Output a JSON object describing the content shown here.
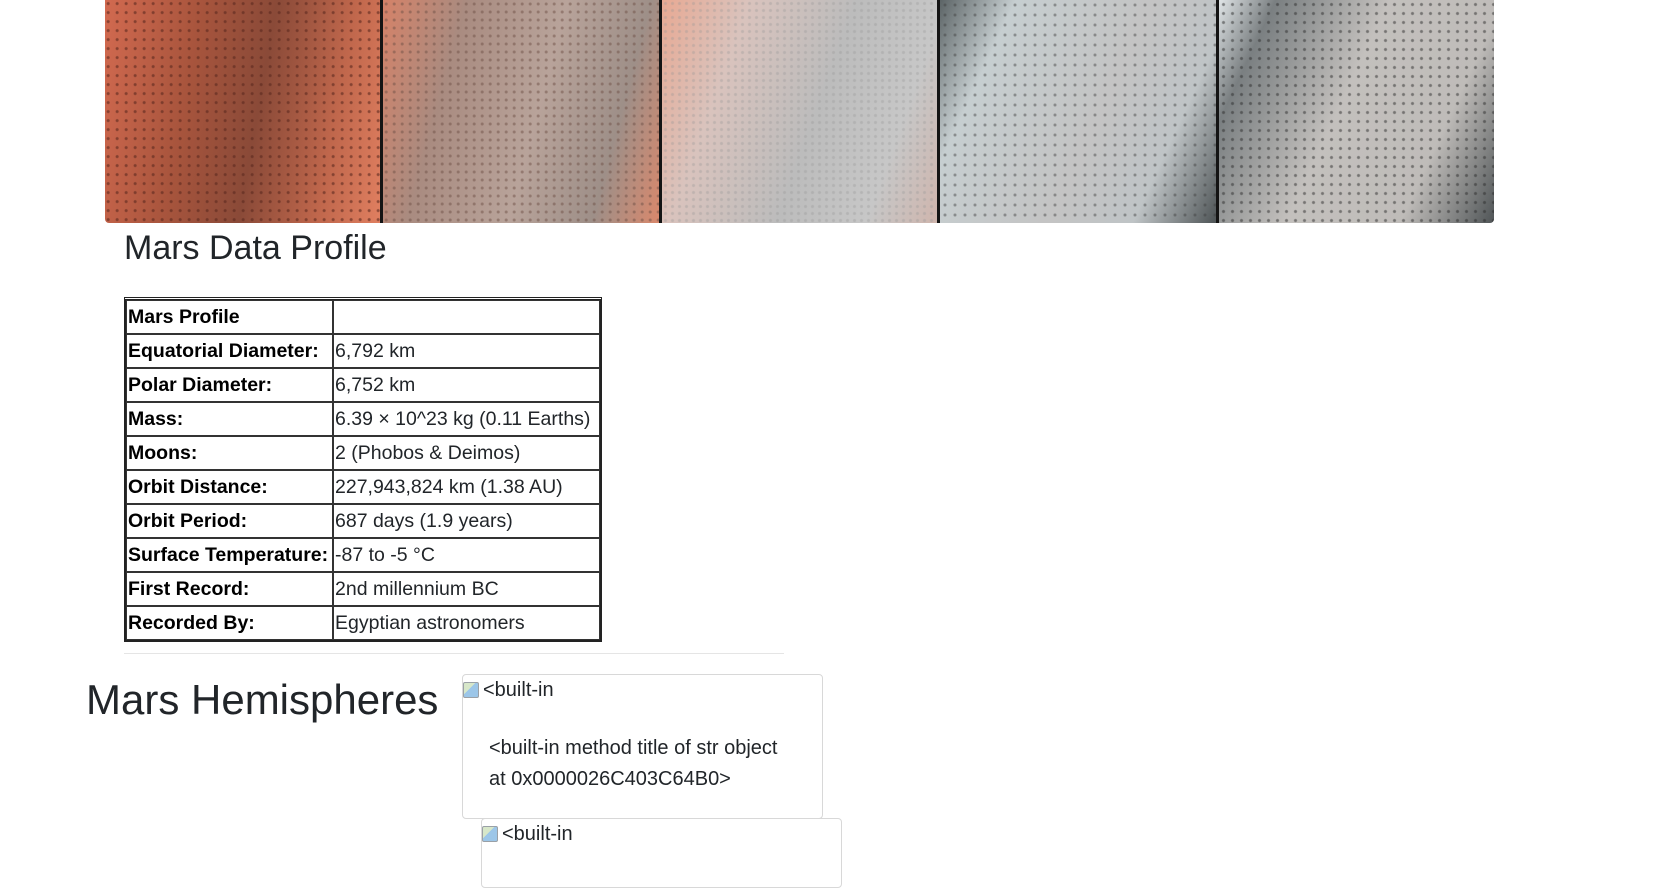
{
  "hero_image": {
    "description_icon": "mars-polar-dunes-image"
  },
  "profile": {
    "heading": "Mars Data Profile",
    "table": [
      {
        "label": "Mars Profile",
        "value": ""
      },
      {
        "label": "Equatorial Diameter:",
        "value": "6,792 km"
      },
      {
        "label": "Polar Diameter:",
        "value": "6,752 km"
      },
      {
        "label": "Mass:",
        "value": "6.39 × 10^23 kg (0.11 Earths)"
      },
      {
        "label": "Moons:",
        "value": "2 (Phobos & Deimos)"
      },
      {
        "label": "Orbit Distance:",
        "value": "227,943,824 km (1.38 AU)"
      },
      {
        "label": "Orbit Period:",
        "value": "687 days (1.9 years)"
      },
      {
        "label": "Surface Temperature:",
        "value": "-87 to -5 °C"
      },
      {
        "label": "First Record:",
        "value": "2nd millennium BC"
      },
      {
        "label": "Recorded By:",
        "value": "Egyptian astronomers"
      }
    ]
  },
  "hemispheres": {
    "heading": "Mars Hemispheres",
    "cards": [
      {
        "alt_text": "<built-in",
        "caption": "<built-in method title of str object at 0x0000026C403C64B0>"
      },
      {
        "alt_text": "<built-in",
        "caption": ""
      }
    ]
  }
}
